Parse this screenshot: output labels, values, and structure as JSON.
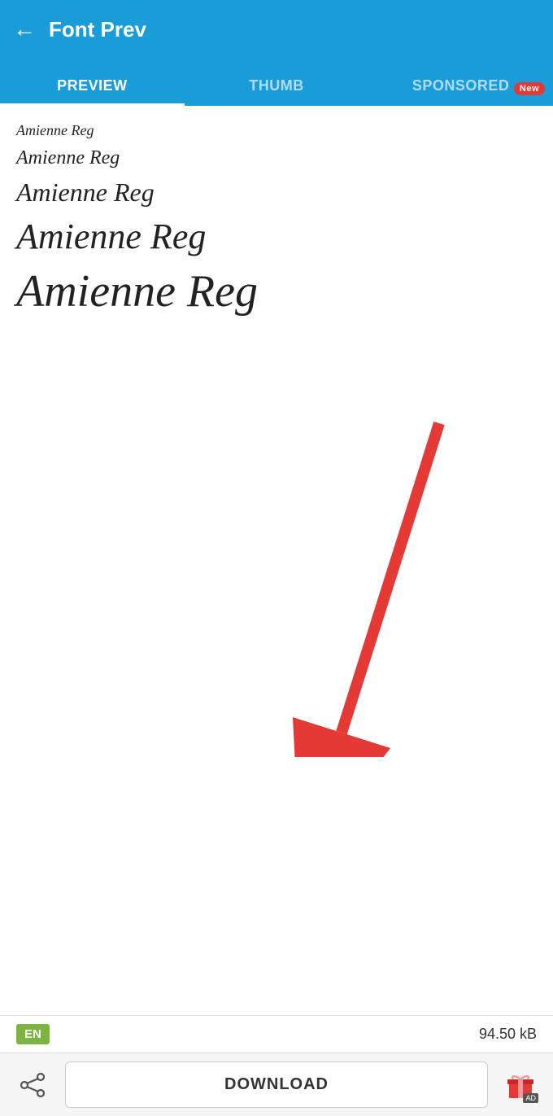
{
  "header": {
    "back_label": "←",
    "title": "Font Prev"
  },
  "tabs": [
    {
      "id": "preview",
      "label": "PREVIEW",
      "active": true
    },
    {
      "id": "thumb",
      "label": "THUMB",
      "active": false
    },
    {
      "id": "sponsored",
      "label": "SPONSORED",
      "active": false,
      "badge": "New"
    }
  ],
  "font_previews": [
    {
      "text": "Amienne Reg",
      "size_class": "fp-1"
    },
    {
      "text": "Amienne Reg",
      "size_class": "fp-2"
    },
    {
      "text": "Amienne Reg",
      "size_class": "fp-3"
    },
    {
      "text": "Amienne Reg",
      "size_class": "fp-4"
    },
    {
      "text": "Amienne Reg",
      "size_class": "fp-5"
    }
  ],
  "info_bar": {
    "lang": "EN",
    "file_size": "94.50 kB"
  },
  "bottom_bar": {
    "download_label": "DOWNLOAD",
    "ad_label": "AD"
  }
}
